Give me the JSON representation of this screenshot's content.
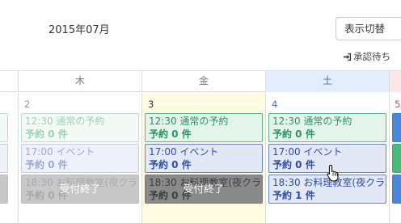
{
  "header": {
    "month": "2015年07月",
    "toggle_label": "表示切替",
    "approval_label": "承認待ち"
  },
  "weekdays": {
    "thu": "木",
    "fri": "金",
    "sat": "土"
  },
  "days": {
    "thu": {
      "number": "2",
      "events": [
        {
          "time": "12:30 通常の予約",
          "count": "予約 0 件"
        },
        {
          "time": "17:00 イベント",
          "count": "予約 0 件"
        },
        {
          "time": "18:30 お料理教室(夜クラ",
          "count": "予約 0 件",
          "overlay": "受付終了"
        }
      ]
    },
    "fri": {
      "number": "3",
      "events": [
        {
          "time": "12:30 通常の予約",
          "count": "予約 0 件"
        },
        {
          "time": "17:00 イベント",
          "count": "予約 0 件"
        },
        {
          "time": "18:30 お料理教室(夜クラ",
          "count": "予約 0 件",
          "overlay": "受付終了"
        }
      ]
    },
    "sat": {
      "number": "4",
      "events": [
        {
          "time": "12:30 通常の予約",
          "count": "予約 0 件"
        },
        {
          "time": "17:00 イベント",
          "count": "予約 0 件"
        },
        {
          "time": "18:30 お料理教室(夜クラ",
          "count": "予約 1 件"
        }
      ]
    },
    "sun": {
      "number": "5"
    }
  },
  "colors": {
    "normal_event": "#2e9362",
    "event": "#2f4e9a",
    "closed_event": "#8a8a8a",
    "saturday": "#e4edfb",
    "sunday": "#fbe7e7",
    "today": "#fffbe1"
  }
}
